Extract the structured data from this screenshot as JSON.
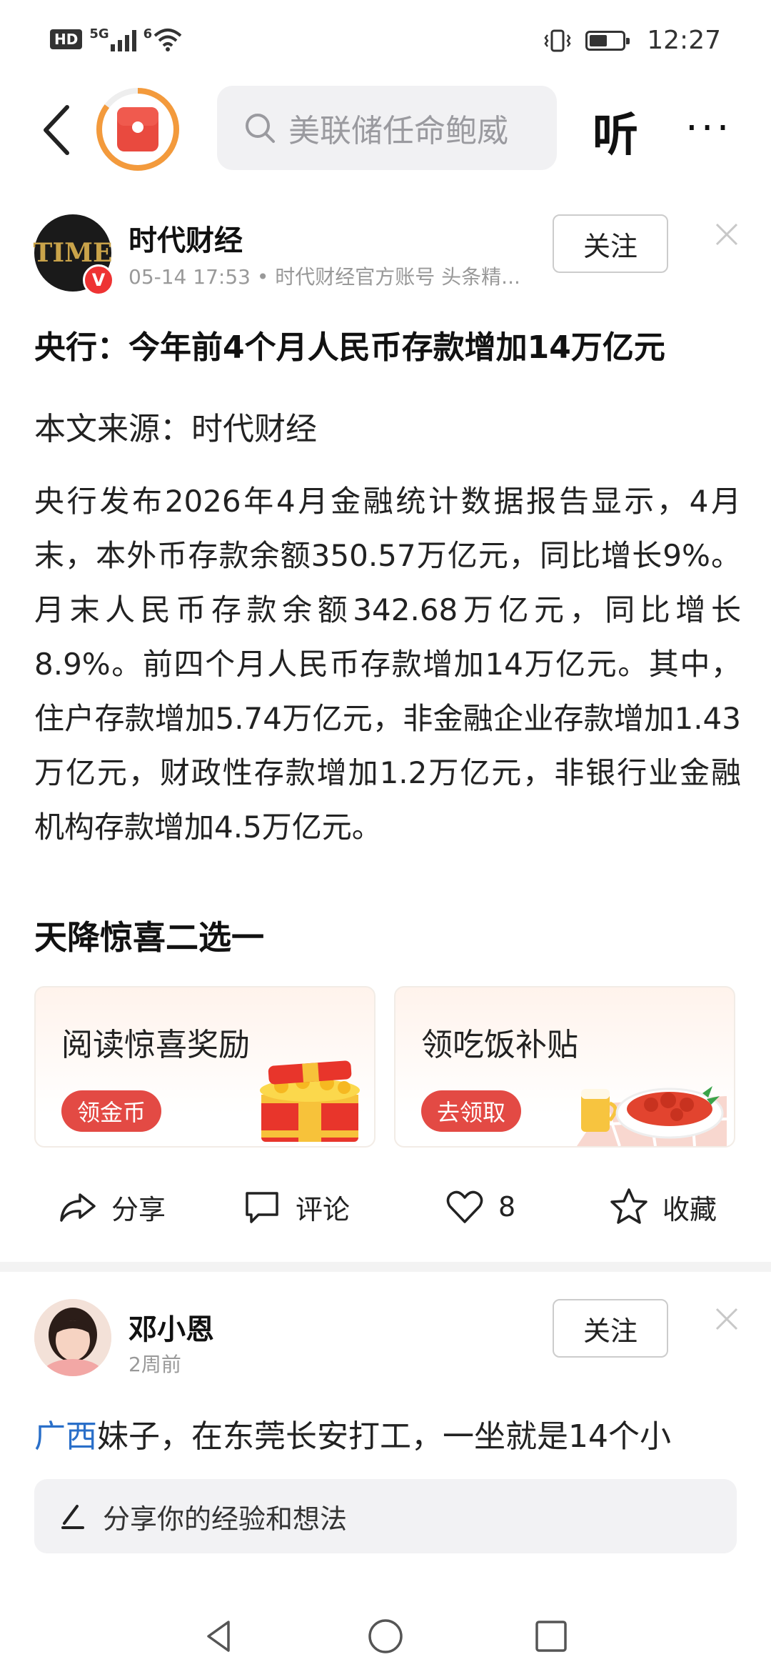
{
  "status_bar": {
    "hd": "HD",
    "network": "5G",
    "wifi_badge": "6",
    "time": "12:27"
  },
  "top_nav": {
    "search_placeholder": "美联储任命鲍威",
    "listen_label": "听",
    "more_label": "···"
  },
  "article": {
    "author_name": "时代财经",
    "avatar_text": "TIME",
    "verified_badge": "V",
    "meta": "05-14 17:53 • 时代财经官方账号 头条精...",
    "follow_label": "关注",
    "title": "央行：今年前4个月人民币存款增加14万亿元",
    "source": "本文来源：时代财经",
    "body": "央行发布2026年4月金融统计数据报告显示，4月末，本外币存款余额350.57万亿元，同比增长9%。月末人民币存款余额342.68万亿元，同比增长8.9%。前四个月人民币存款增加14万亿元。其中，住户存款增加5.74万亿元，非金融企业存款增加1.43万亿元，财政性存款增加1.2万亿元，非银行业金融机构存款增加4.5万亿元。",
    "subhead": "天降惊喜二选一"
  },
  "promo": {
    "card1": {
      "title": "阅读惊喜奖励",
      "button": "领金币"
    },
    "card2": {
      "title": "领吃饭补贴",
      "button": "去领取"
    }
  },
  "actions": {
    "share": "分享",
    "comment": "评论",
    "like_count": "8",
    "favorite": "收藏"
  },
  "post": {
    "name": "邓小恩",
    "time": "2周前",
    "follow_label": "关注",
    "location_tag": "广西",
    "text": "妹子，在东莞长安打工，一坐就是14个小"
  },
  "comment_bar": {
    "placeholder": "分享你的经验和想法"
  },
  "colors": {
    "accent_red": "#e34a44",
    "progress_orange": "#f39a3c",
    "link_blue": "#2a6fc9"
  }
}
